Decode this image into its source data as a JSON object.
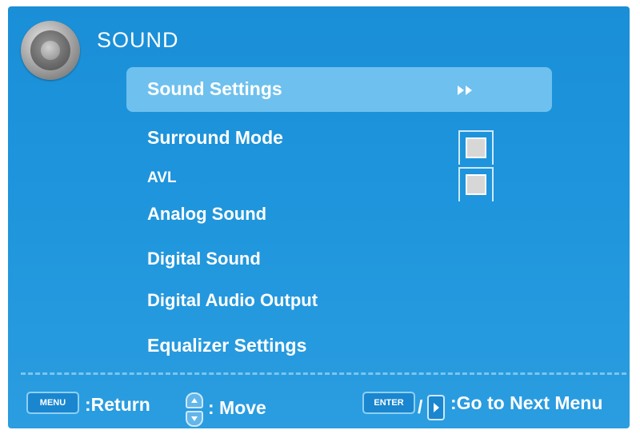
{
  "header": {
    "title": "SOUND",
    "icon": "speaker-icon"
  },
  "menu": {
    "items": [
      {
        "label": "Sound Settings",
        "selected": true,
        "submenu_icon": "double-arrow-right-icon"
      },
      {
        "label": "Surround Mode",
        "checkbox": false
      },
      {
        "label": "AVL",
        "checkbox": false
      },
      {
        "label": "Analog Sound"
      },
      {
        "label": "Digital Sound"
      },
      {
        "label": "Digital Audio Output"
      },
      {
        "label": "Equalizer Settings"
      }
    ]
  },
  "footer": {
    "menu_key": "MENU",
    "return_label": ":Return",
    "move_label": ": Move",
    "enter_key": "ENTER",
    "next_label": ":Go to Next Menu"
  },
  "colors": {
    "background": "#1e95dc",
    "highlight": "#6ec0ee",
    "text": "#ffffff"
  }
}
